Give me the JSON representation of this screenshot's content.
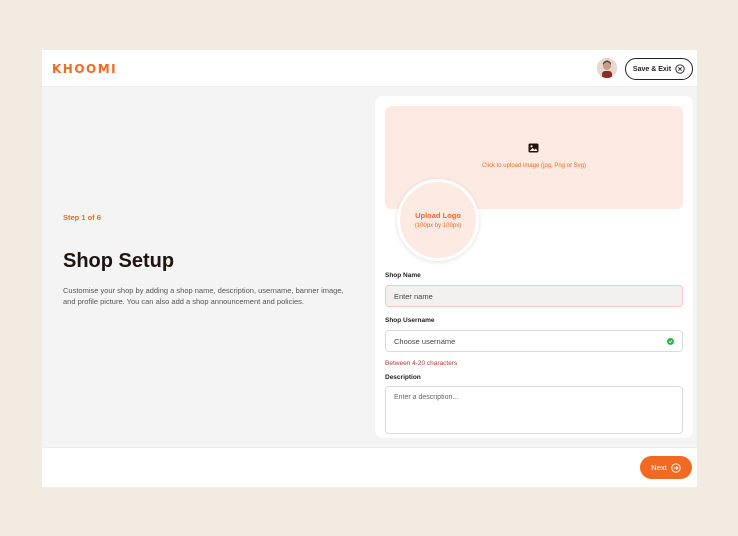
{
  "header": {
    "brand": "KHOOMI",
    "save_exit_label": "Save & Exit"
  },
  "intro": {
    "step": "Step 1 of 6",
    "title": "Shop Setup",
    "description": "Customise your shop by adding a shop name, description, username, banner image, and profile picture. You can also add a shop announcement and policies."
  },
  "form": {
    "banner_upload_text": "Click to upload image (jpg, Png or Svg)",
    "logo_upload_title": "Upload Logo",
    "logo_upload_size": "(100px by 100px)",
    "shop_name_label": "Shop Name",
    "shop_name_placeholder": "Enter name",
    "shop_username_label": "Shop Username",
    "shop_username_placeholder": "Choose username",
    "shop_username_hint": "Between 4-20 characters",
    "description_label": "Description",
    "description_placeholder": "Enter a description..."
  },
  "footer": {
    "next_label": "Next"
  },
  "colors": {
    "accent": "#f26a21",
    "success": "#2fb34a",
    "error": "#c0392b"
  },
  "icons": {
    "save_exit": "close-circle-icon",
    "banner": "image-icon",
    "username_status": "check-circle-icon",
    "next": "arrow-right-circle-icon"
  }
}
